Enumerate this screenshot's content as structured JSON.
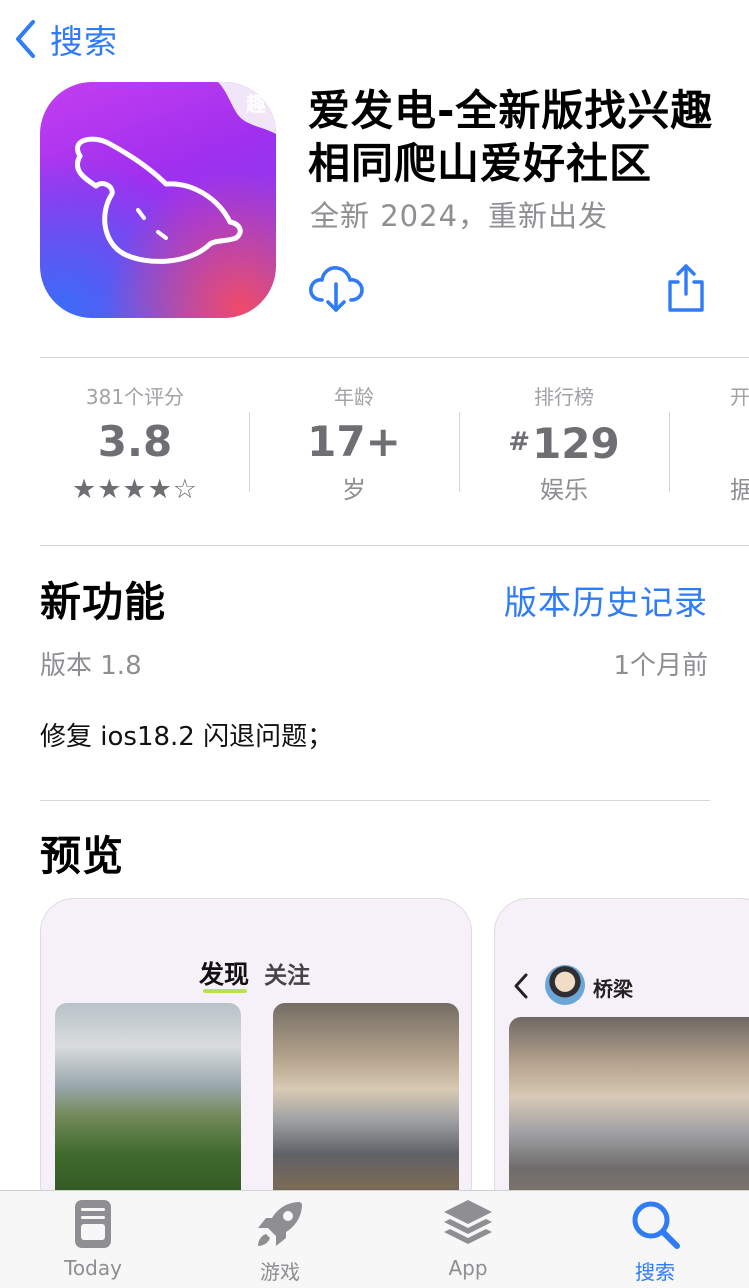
{
  "nav": {
    "back_label": "搜索"
  },
  "app": {
    "icon_char": "趣",
    "title": "爱发电-全新版找兴趣相同爬山爱好社区",
    "subtitle": "全新 2024，重新出发"
  },
  "info": [
    {
      "top": "381个评分",
      "main": "3.8",
      "bottom": "★★★★☆"
    },
    {
      "top": "年龄",
      "main": "17+",
      "bottom": "岁"
    },
    {
      "top": "排行榜",
      "hash": "#",
      "main": "129",
      "bottom": "娱乐"
    },
    {
      "top": "开",
      "bottom": "据"
    }
  ],
  "rating_value": 3.8,
  "whats_new": {
    "title": "新功能",
    "history_link": "版本历史记录",
    "version": "版本 1.8",
    "date": "1个月前",
    "notes": "修复 ios18.2 闪退问题；"
  },
  "preview": {
    "title": "预览",
    "card1_tabs": [
      "发现",
      "关注"
    ],
    "card2_user": "桥梁"
  },
  "tabbar": {
    "items": [
      {
        "label": "Today",
        "icon": "today-icon"
      },
      {
        "label": "游戏",
        "icon": "rocket-icon"
      },
      {
        "label": "App",
        "icon": "apps-stack-icon"
      },
      {
        "label": "搜索",
        "icon": "search-icon",
        "active": true
      }
    ]
  },
  "colors": {
    "accent": "#2f7cf6",
    "secondary_text": "#8e8e93"
  }
}
